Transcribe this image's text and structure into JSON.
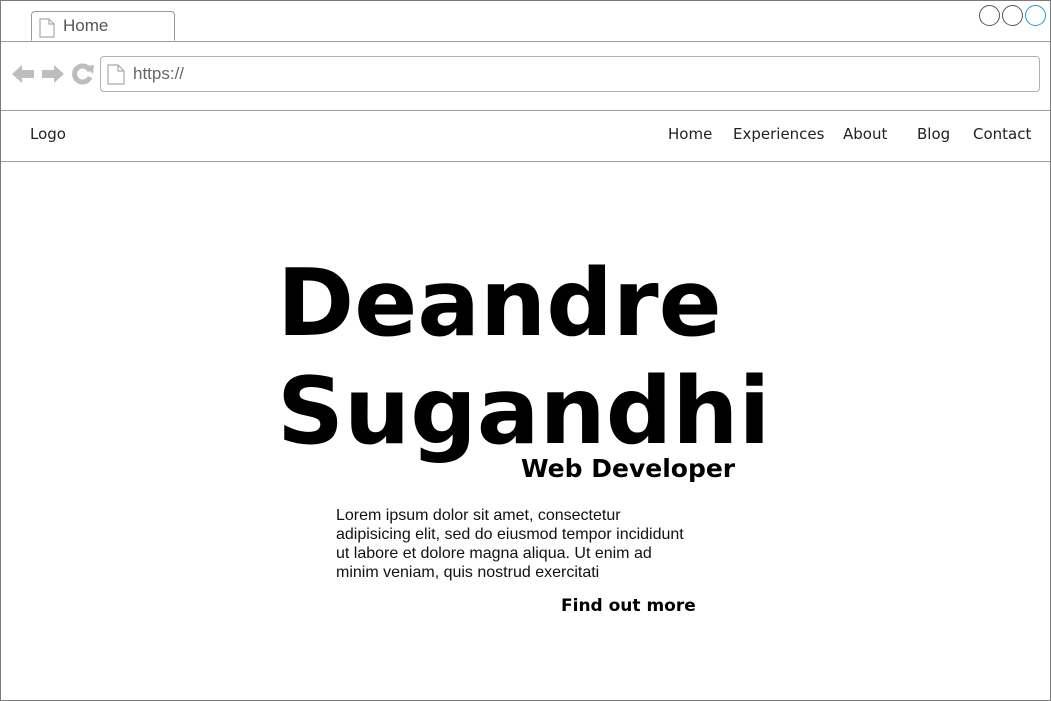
{
  "browser": {
    "tab_title": "Home",
    "url": "https://"
  },
  "site": {
    "logo": "Logo",
    "nav": [
      "Home",
      "Experiences",
      "About",
      "Blog",
      "Contact"
    ]
  },
  "hero": {
    "first_name": "Deandre",
    "last_name": "Sugandhi",
    "role": "Web Developer",
    "description": "Lorem ipsum dolor sit amet, consectetur adipisicing elit, sed do eiusmod tempor incididunt ut labore et dolore magna aliqua. Ut enim ad minim veniam, quis nostrud exercitati",
    "cta": "Find out more"
  },
  "colors": {
    "active_window_button": "#1f9ad6",
    "border": "#9a9a9a"
  }
}
